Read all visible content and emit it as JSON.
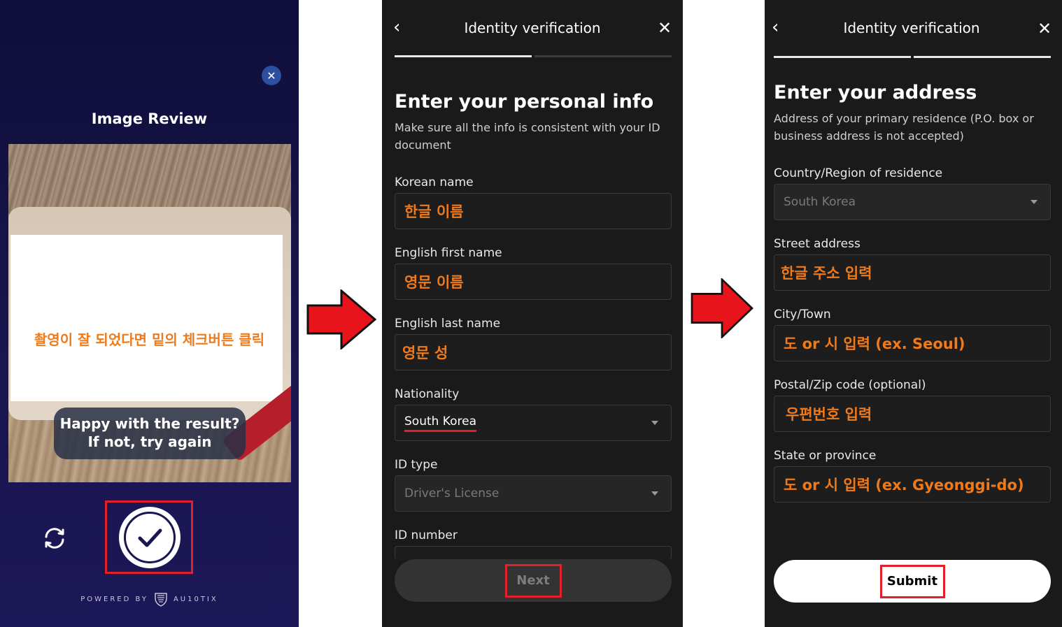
{
  "panel1": {
    "title": "Image Review",
    "instruction": "촬영이 잘 되었다면 밑의 체크버튼 클릭",
    "bubble_line1": "Happy with the result?",
    "bubble_line2": "If not, try again",
    "powered_by": "POWERED BY",
    "brand": "AU10TIX"
  },
  "panel2": {
    "header_title": "Identity verification",
    "heading": "Enter your personal info",
    "subheading": "Make sure all the info is consistent with your ID document",
    "fields": [
      {
        "label": "Korean name",
        "value": "한글 이름"
      },
      {
        "label": "English first name",
        "value": "영문 이름"
      },
      {
        "label": "English last name",
        "value": "영문 성"
      },
      {
        "label": "Nationality",
        "value": "South Korea"
      },
      {
        "label": "ID type",
        "value": "Driver's License"
      },
      {
        "label": "ID number",
        "value": ""
      }
    ],
    "next_label": "Next"
  },
  "panel3": {
    "header_title": "Identity verification",
    "heading": "Enter your address",
    "subheading": "Address of your primary residence (P.O. box or business address is not accepted)",
    "fields": [
      {
        "label": "Country/Region of residence",
        "value": "South Korea"
      },
      {
        "label": "Street address",
        "value": "한글 주소 입력"
      },
      {
        "label": "City/Town",
        "value": "도 or 시 입력 (ex. Seoul)"
      },
      {
        "label": "Postal/Zip code (optional)",
        "value": "우편번호 입력"
      },
      {
        "label": "State or province",
        "value": "도 or 시 입력 (ex. Gyeonggi-do)"
      }
    ],
    "submit_label": "Submit"
  },
  "colors": {
    "annotation_orange": "#f07a1a",
    "highlight_red": "#e0202a",
    "arrow_red": "#e8141c"
  },
  "icons": [
    "close-icon",
    "refresh-icon",
    "check-icon",
    "back-chevron-icon",
    "dropdown-caret-icon",
    "next-arrow-icon"
  ]
}
